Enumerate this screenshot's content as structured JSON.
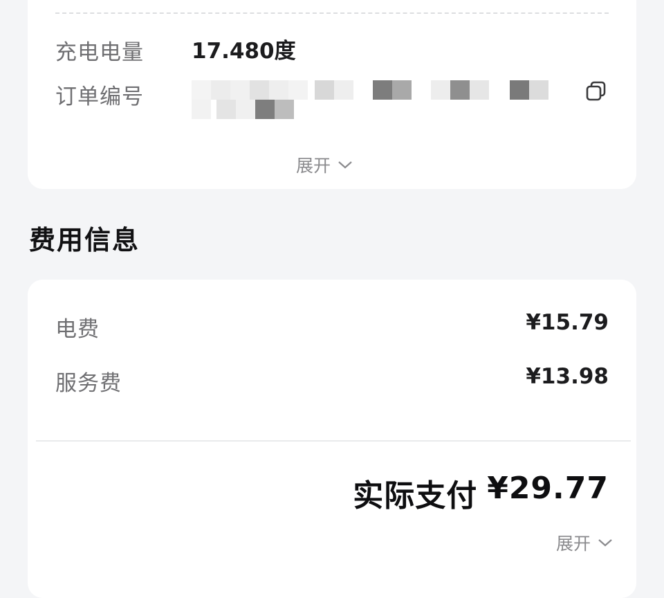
{
  "order": {
    "charge_amount_label": "充电电量",
    "charge_amount_value": "17.480度",
    "order_no_label": "订单编号",
    "order_no_icon": "copy-icon",
    "expand_label": "展开",
    "expand_icon": "chevron-down-icon"
  },
  "fees": {
    "section_title": "费用信息",
    "items": [
      {
        "label": "电费",
        "amount": "¥15.79"
      },
      {
        "label": "服务费",
        "amount": "¥13.98"
      }
    ],
    "total_label": "实际支付",
    "total_amount": "¥29.77",
    "expand_label": "展开",
    "expand_icon": "chevron-down-icon"
  }
}
